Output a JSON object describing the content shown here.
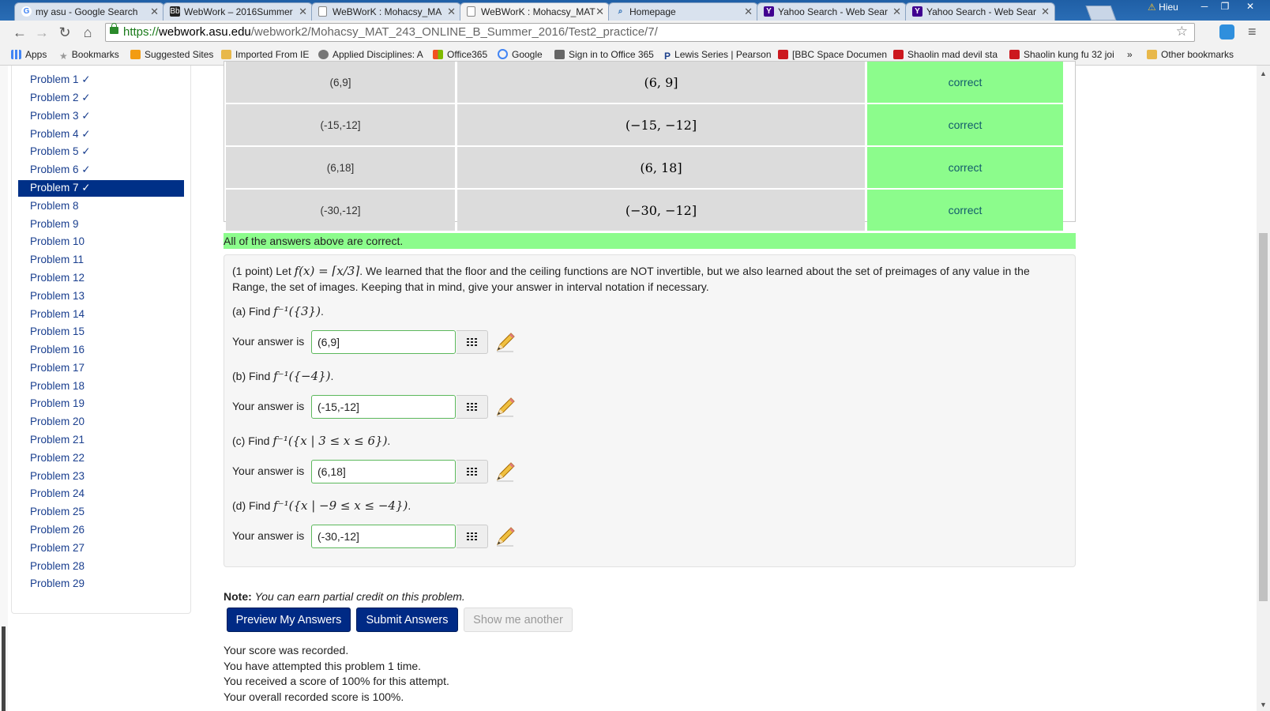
{
  "browser": {
    "tabs": [
      {
        "title": "my asu - Google Search",
        "icon": "google-icon"
      },
      {
        "title": "WebWork – 2016Summer",
        "icon": "blackboard-icon"
      },
      {
        "title": "WeBWorK : Mohacsy_MA",
        "icon": "page-icon"
      },
      {
        "title": "WeBWorK : Mohacsy_MAT",
        "icon": "page-icon",
        "active": true
      },
      {
        "title": "Homepage",
        "icon": "search-icon"
      },
      {
        "title": "Yahoo Search - Web Sear",
        "icon": "yahoo-icon"
      },
      {
        "title": "Yahoo Search - Web Sear",
        "icon": "yahoo-icon"
      }
    ],
    "profile": "Hieu",
    "url": {
      "scheme": "https://",
      "host": "webwork.asu.edu",
      "path": "/webwork2/Mohacsy_MAT_243_ONLINE_B_Summer_2016/Test2_practice/7/"
    },
    "bookmarks": [
      "Apps",
      "Bookmarks",
      "Suggested Sites",
      "Imported From IE",
      "Applied Disciplines: A",
      "Office365",
      "Google",
      "Sign in to Office 365",
      "Lewis Series | Pearson",
      "[BBC Space Documen",
      "Shaolin mad devil sta",
      "Shaolin kung fu 32 joi",
      "»",
      "Other bookmarks"
    ]
  },
  "sidebar": {
    "items": [
      {
        "label": "Problem 1 ✓"
      },
      {
        "label": "Problem 2 ✓"
      },
      {
        "label": "Problem 3 ✓"
      },
      {
        "label": "Problem 4 ✓"
      },
      {
        "label": "Problem 5 ✓"
      },
      {
        "label": "Problem 6 ✓"
      },
      {
        "label": "Problem 7 ✓",
        "active": true
      },
      {
        "label": "Problem 8"
      },
      {
        "label": "Problem 9"
      },
      {
        "label": "Problem 10"
      },
      {
        "label": "Problem 11"
      },
      {
        "label": "Problem 12"
      },
      {
        "label": "Problem 13"
      },
      {
        "label": "Problem 14"
      },
      {
        "label": "Problem 15"
      },
      {
        "label": "Problem 16"
      },
      {
        "label": "Problem 17"
      },
      {
        "label": "Problem 18"
      },
      {
        "label": "Problem 19"
      },
      {
        "label": "Problem 20"
      },
      {
        "label": "Problem 21"
      },
      {
        "label": "Problem 22"
      },
      {
        "label": "Problem 23"
      },
      {
        "label": "Problem 24"
      },
      {
        "label": "Problem 25"
      },
      {
        "label": "Problem 26"
      },
      {
        "label": "Problem 27"
      },
      {
        "label": "Problem 28"
      },
      {
        "label": "Problem 29"
      }
    ]
  },
  "results": {
    "rows": [
      {
        "entered": "(6,9]",
        "preview": "(6, 9]",
        "status": "correct"
      },
      {
        "entered": "(-15,-12]",
        "preview": "(−15, −12]",
        "status": "correct"
      },
      {
        "entered": "(6,18]",
        "preview": "(6, 18]",
        "status": "correct"
      },
      {
        "entered": "(-30,-12]",
        "preview": "(−30, −12]",
        "status": "correct"
      }
    ],
    "summary": "All of the answers above are correct."
  },
  "problem": {
    "intro_points": "(1 point) Let ",
    "intro_func": "f(x) = ⌈x/3⌉",
    "intro_rest": ". We learned that the floor and the ceiling functions are NOT invertible, but we also learned about the set of preimages of any value in the Range, the set of images. Keeping that in mind, give your answer in interval notation if necessary.",
    "answer_label": "Your answer is",
    "parts": [
      {
        "label": "(a) Find ",
        "math": "f⁻¹({3})",
        "value": "(6,9]"
      },
      {
        "label": "(b) Find ",
        "math": "f⁻¹({−4})",
        "value": "(-15,-12]"
      },
      {
        "label": "(c) Find ",
        "math": "f⁻¹({x | 3 ≤ x ≤ 6})",
        "value": "(6,18]"
      },
      {
        "label": "(d) Find ",
        "math": "f⁻¹({x | −9 ≤ x ≤ −4})",
        "value": "(-30,-12]"
      }
    ]
  },
  "note": {
    "label": "Note:",
    "text": "You can earn partial credit on this problem."
  },
  "buttons": {
    "preview": "Preview My Answers",
    "submit": "Submit Answers",
    "another": "Show me another"
  },
  "score": {
    "recorded": "Your score was recorded.",
    "attempts": "You have attempted this problem 1 time.",
    "received": "You received a score of 100% for this attempt.",
    "overall": "Your overall recorded score is 100%."
  }
}
